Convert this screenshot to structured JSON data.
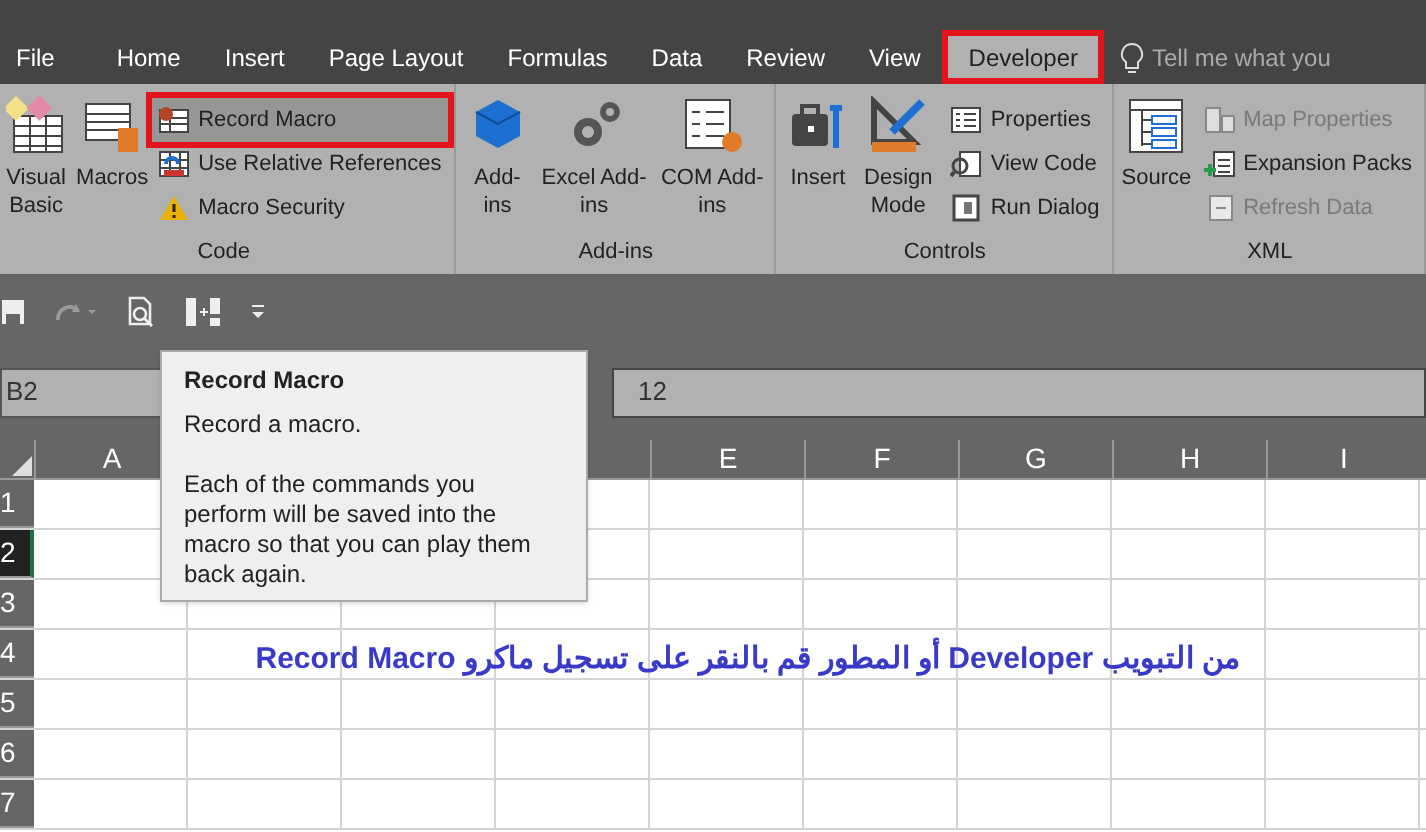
{
  "tabs": [
    {
      "label": "File",
      "selected": false
    },
    {
      "label": "Home",
      "selected": false
    },
    {
      "label": "Insert",
      "selected": false
    },
    {
      "label": "Page Layout",
      "selected": false
    },
    {
      "label": "Formulas",
      "selected": false
    },
    {
      "label": "Data",
      "selected": false
    },
    {
      "label": "Review",
      "selected": false
    },
    {
      "label": "View",
      "selected": false
    },
    {
      "label": "Developer",
      "selected": true
    }
  ],
  "tell_me": {
    "placeholder": "Tell me what you"
  },
  "ribbon_groups": [
    {
      "label": "Code",
      "large": [
        {
          "label": "Visual Basic"
        },
        {
          "label": "Macros"
        }
      ],
      "small": [
        {
          "label": "Record Macro",
          "highlighted": true,
          "disabled": false
        },
        {
          "label": "Use Relative References",
          "highlighted": false,
          "disabled": false
        },
        {
          "label": "Macro Security",
          "highlighted": false,
          "disabled": false
        }
      ]
    },
    {
      "label": "Add-ins",
      "large": [
        {
          "label": "Add-ins"
        },
        {
          "label": "Excel Add-ins"
        },
        {
          "label": "COM Add-ins"
        }
      ]
    },
    {
      "label": "Controls",
      "large": [
        {
          "label": "Insert"
        },
        {
          "label": "Design Mode"
        }
      ],
      "small": [
        {
          "label": "Properties",
          "highlighted": false,
          "disabled": false
        },
        {
          "label": "View Code",
          "highlighted": false,
          "disabled": false
        },
        {
          "label": "Run Dialog",
          "highlighted": false,
          "disabled": false
        }
      ]
    },
    {
      "label": "XML",
      "large": [
        {
          "label": "Source"
        }
      ],
      "small": [
        {
          "label": "Map Properties",
          "highlighted": false,
          "disabled": true
        },
        {
          "label": "Expansion Packs",
          "highlighted": false,
          "disabled": false
        },
        {
          "label": "Refresh Data",
          "highlighted": false,
          "disabled": true
        }
      ]
    }
  ],
  "name_box": "B2",
  "formula": "12",
  "tooltip": {
    "title": "Record Macro",
    "lines": [
      "Record a macro.",
      "Each of the commands you perform will be saved into the macro so that you can play them back again."
    ]
  },
  "columns": [
    "A",
    "E",
    "F",
    "G",
    "H",
    "I"
  ],
  "rows": [
    {
      "label": "1",
      "selected": false
    },
    {
      "label": "2",
      "selected": true
    },
    {
      "label": "3",
      "selected": false
    },
    {
      "label": "4",
      "selected": false,
      "note": "من التبويب Developer أو المطور قم بالنقر على تسجيل ماكرو Record Macro"
    },
    {
      "label": "5",
      "selected": false
    },
    {
      "label": "6",
      "selected": false
    },
    {
      "label": "7",
      "selected": false
    }
  ]
}
